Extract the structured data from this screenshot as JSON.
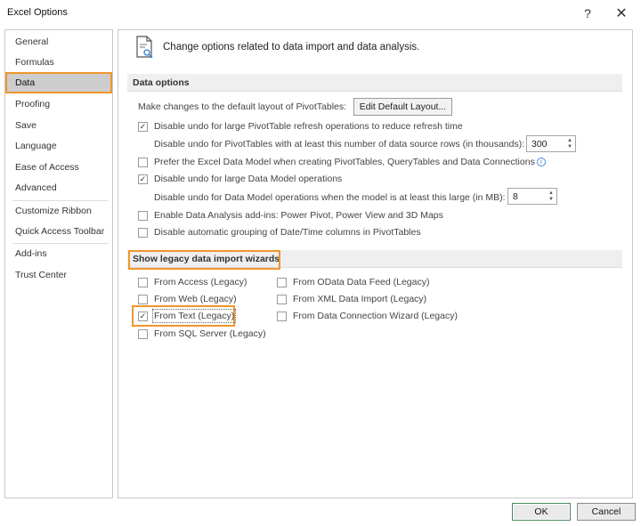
{
  "window": {
    "title": "Excel Options",
    "help_glyph": "?",
    "close_glyph": "✕"
  },
  "sidebar": {
    "items": [
      {
        "label": "General"
      },
      {
        "label": "Formulas"
      },
      {
        "label": "Data",
        "active": true
      },
      {
        "label": "Proofing"
      },
      {
        "label": "Save"
      },
      {
        "label": "Language"
      },
      {
        "label": "Ease of Access"
      },
      {
        "label": "Advanced"
      },
      {
        "label": "Customize Ribbon"
      },
      {
        "label": "Quick Access Toolbar"
      },
      {
        "label": "Add-ins"
      },
      {
        "label": "Trust Center"
      }
    ]
  },
  "header": {
    "icon": "data-analysis-icon",
    "text": "Change options related to data import and data analysis."
  },
  "data_options": {
    "section_title": "Data options",
    "pivot_layout_label": "Make changes to the default layout of PivotTables:",
    "edit_layout_button": "Edit Default Layout...",
    "disable_undo_pivot": {
      "label": "Disable undo for large PivotTable refresh operations to reduce refresh time",
      "checked": true
    },
    "pivot_rows_label": "Disable undo for PivotTables with at least this number of data source rows (in thousands):",
    "pivot_rows_value": "300",
    "prefer_data_model": {
      "label": "Prefer the Excel Data Model when creating PivotTables, QueryTables and Data Connections",
      "checked": false
    },
    "disable_undo_model": {
      "label": "Disable undo for large Data Model operations",
      "checked": true
    },
    "model_size_label": "Disable undo for Data Model operations when the model is at least this large (in MB):",
    "model_size_value": "8",
    "enable_addins": {
      "label": "Enable Data Analysis add-ins: Power Pivot, Power View and 3D Maps",
      "checked": false
    },
    "disable_grouping": {
      "label": "Disable automatic grouping of Date/Time columns in PivotTables",
      "checked": false
    }
  },
  "legacy": {
    "section_title": "Show legacy data import wizards",
    "from_access": {
      "label": "From Access (Legacy)",
      "checked": false
    },
    "from_web": {
      "label": "From Web (Legacy)",
      "checked": false
    },
    "from_text": {
      "label": "From Text (Legacy)",
      "checked": true
    },
    "from_sql": {
      "label": "From SQL Server (Legacy)",
      "checked": false
    },
    "from_odata": {
      "label": "From OData Data Feed (Legacy)",
      "checked": false
    },
    "from_xml": {
      "label": "From XML Data Import (Legacy)",
      "checked": false
    },
    "from_dcw": {
      "label": "From Data Connection Wizard (Legacy)",
      "checked": false
    }
  },
  "footer": {
    "ok": "OK",
    "cancel": "Cancel"
  },
  "colors": {
    "highlight": "#f0962b",
    "selected_nav": "#cdcdcd",
    "section_bar": "#efefef"
  },
  "check_glyph": "✓"
}
